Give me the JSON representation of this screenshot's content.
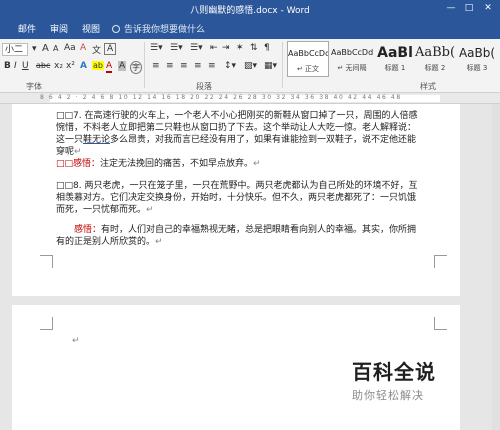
{
  "window": {
    "title": "八则幽默的感悟.docx - Word",
    "min": "—",
    "max": "□",
    "close": "✕"
  },
  "tabs": [
    {
      "label": "邮件"
    },
    {
      "label": "审阅"
    },
    {
      "label": "视图"
    }
  ],
  "tell_me": "告诉我你想要做什么",
  "ribbon": {
    "font_name": "小二",
    "font_grow": "A",
    "font_shrink": "A",
    "aa": "Aa",
    "clear": "A",
    "wen": "文",
    "a_box": "A",
    "bold": "B",
    "italic": "I",
    "underline": "U",
    "strike": "abc",
    "sub": "x₂",
    "sup": "x²",
    "text_effect": "A",
    "highlight": "ab",
    "font_color": "A",
    "shading": "A",
    "circle_char": "字",
    "groups": {
      "font": "字体",
      "paragraph": "段落",
      "styles": "样式"
    },
    "styles": [
      {
        "preview": "AaBbCcDd",
        "name": "↵ 正文"
      },
      {
        "preview": "AaBbCcDd",
        "name": "↵ 无间隔"
      },
      {
        "preview": "AaBl",
        "name": "标题 1"
      },
      {
        "preview": "AaBb(",
        "name": "标题 2"
      },
      {
        "preview": "AaBb(",
        "name": "标题 3"
      }
    ]
  },
  "ruler": {
    "ticks": "8 6 4 2 · 2 4 6 8 10 12 14 16 18 20 22 24 26 28 30 32 34 36 38 40 42 44 46 48"
  },
  "page1": {
    "p1_a": "□□7. 在高速行驶的火车上，一个老人不小心把刚买的新鞋从窗口掉了一只，周围的人倍感惋惜，不料老人立即把第二只鞋也从窗口扔了下去。这个举动让人大吃一惊。老人解释说：这一只",
    "p1_u": "鞋无论",
    "p1_b": "多么昂贵，对我而言已经没有用了，如果有谁能捡到一双鞋子，说不定他还能穿呢",
    "p1_mark": "↵",
    "p2_label": "□□感悟：",
    "p2_text": "注定无法挽回的痛苦，不如早点放弃。",
    "p2_mark": "↵",
    "p3": "□□8. 两只老虎，一只在笼子里，一只在荒野中。两只老虎都认为自己所处的环境不好，互相羡慕对方。它们决定交换身份，开始时，十分快乐。但不久，两只老虎都死了：一只饥饿而死，一只忧郁而死。",
    "p3_mark": "↵",
    "p4_label": "感悟：",
    "p4_text": "有时，人们对自己的幸福熟视无睹，总是把眼睛看向别人的幸福。其实，你所拥有的正是别人所欣赏的。",
    "p4_mark": "↵"
  },
  "page2": {
    "mark": "↵"
  },
  "watermark": {
    "title": "百科全说",
    "subtitle": "助你轻松解决"
  }
}
